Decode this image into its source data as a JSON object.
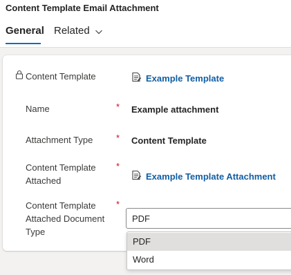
{
  "header": {
    "entity_title": "Content Template Email Attachment",
    "tabs": [
      {
        "label": "General",
        "selected": true
      },
      {
        "label": "Related",
        "selected": false
      }
    ],
    "accent_color": "#0f6cbd"
  },
  "form": {
    "fields": [
      {
        "label": "Content Template",
        "locked": true,
        "required": false,
        "value": "Example Template",
        "value_type": "lookup"
      },
      {
        "label": "Name",
        "required": true,
        "value": "Example attachment",
        "value_type": "text"
      },
      {
        "label": "Attachment Type",
        "required": true,
        "value": "Content Template",
        "value_type": "text"
      },
      {
        "label_lines": [
          "Content Template",
          "Attached"
        ],
        "required": true,
        "value": "Example Template Attachment",
        "value_type": "lookup"
      },
      {
        "label_lines": [
          "Content Template",
          "Attached Document",
          "Type"
        ],
        "required": true,
        "value": "PDF",
        "value_type": "select"
      }
    ],
    "required_marker": "*",
    "required_color": "#c50f1f",
    "link_color": "#115ea3"
  },
  "dropdown": {
    "options": [
      "PDF",
      "Word"
    ],
    "highlighted": "PDF"
  }
}
